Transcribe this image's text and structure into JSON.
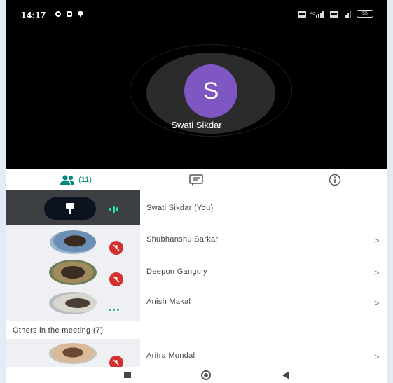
{
  "status_bar": {
    "time": "14:17",
    "battery": "55"
  },
  "video": {
    "avatar_letter": "S",
    "participant_name": "Swati Sikdar",
    "avatar_color": "#7e57c2"
  },
  "tabs": {
    "people_count": "(11)",
    "accent": "#00897b"
  },
  "participants": [
    {
      "name": "Swati Sikdar (You)"
    },
    {
      "name": "Shubhanshu Sarkar",
      "chevron": ">"
    },
    {
      "name": "Deepon Ganguly",
      "chevron": ">"
    },
    {
      "name": "Anish Makal",
      "chevron": ">"
    }
  ],
  "others": {
    "heading": "Others in the meeting (7)",
    "participants": [
      {
        "name": "Aritra Mondal",
        "chevron": ">"
      }
    ]
  },
  "icons": {
    "people": "people-icon",
    "chat": "chat-icon",
    "info": "info-icon",
    "pin": "pin-icon",
    "mute": "mic-off-icon"
  }
}
